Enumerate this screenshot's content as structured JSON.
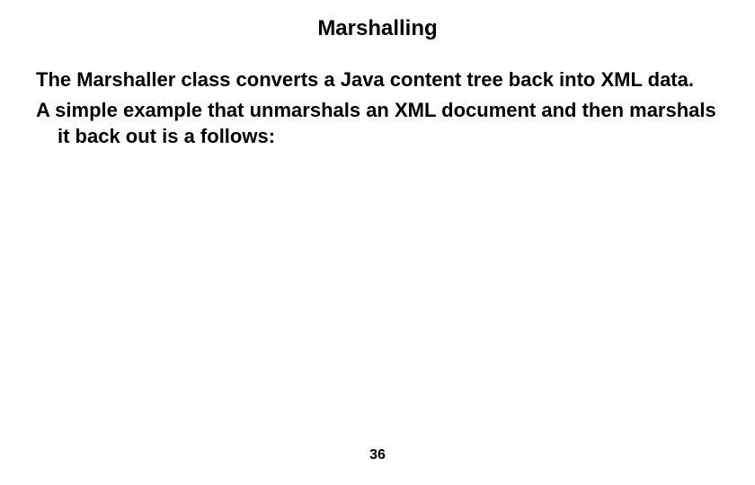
{
  "slide": {
    "title": "Marshalling",
    "paragraph1": "The Marshaller class converts a Java content tree back into XML data.",
    "paragraph2": "A simple example that unmarshals an XML document and then marshals it back out is a follows:",
    "pageNumber": "36"
  }
}
